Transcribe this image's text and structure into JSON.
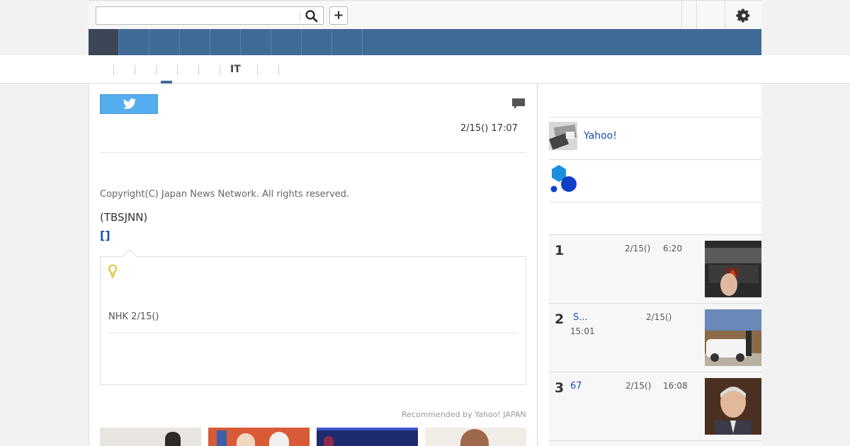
{
  "header": {
    "search": {
      "value": "",
      "placeholder": ""
    },
    "plus_label": "+"
  },
  "subnav": {
    "active_label": "IT"
  },
  "article": {
    "date": "2/15() 17:07",
    "copyright": "Copyright(C) Japan News Network. All rights reserved.",
    "source": "(TBSJNN)",
    "link_label": "[]",
    "callout_text": "NHK 2/15()",
    "recommended": "Recommended by Yahoo! JAPAN"
  },
  "sidebar": {
    "yahoo_label": "Yahoo!",
    "ranking": [
      {
        "rank": "1",
        "title": "",
        "date": "2/15()",
        "time": "6:20"
      },
      {
        "rank": "2",
        "title": "S...",
        "date": "2/15()",
        "time": "15:01"
      },
      {
        "rank": "3",
        "title": "67",
        "date": "2/15()",
        "time": "16:08"
      }
    ]
  },
  "colors": {
    "nav_blue": "#416b97",
    "nav_active": "#3c4657",
    "twitter_blue": "#55acee",
    "link_blue": "#1a4fb5"
  }
}
